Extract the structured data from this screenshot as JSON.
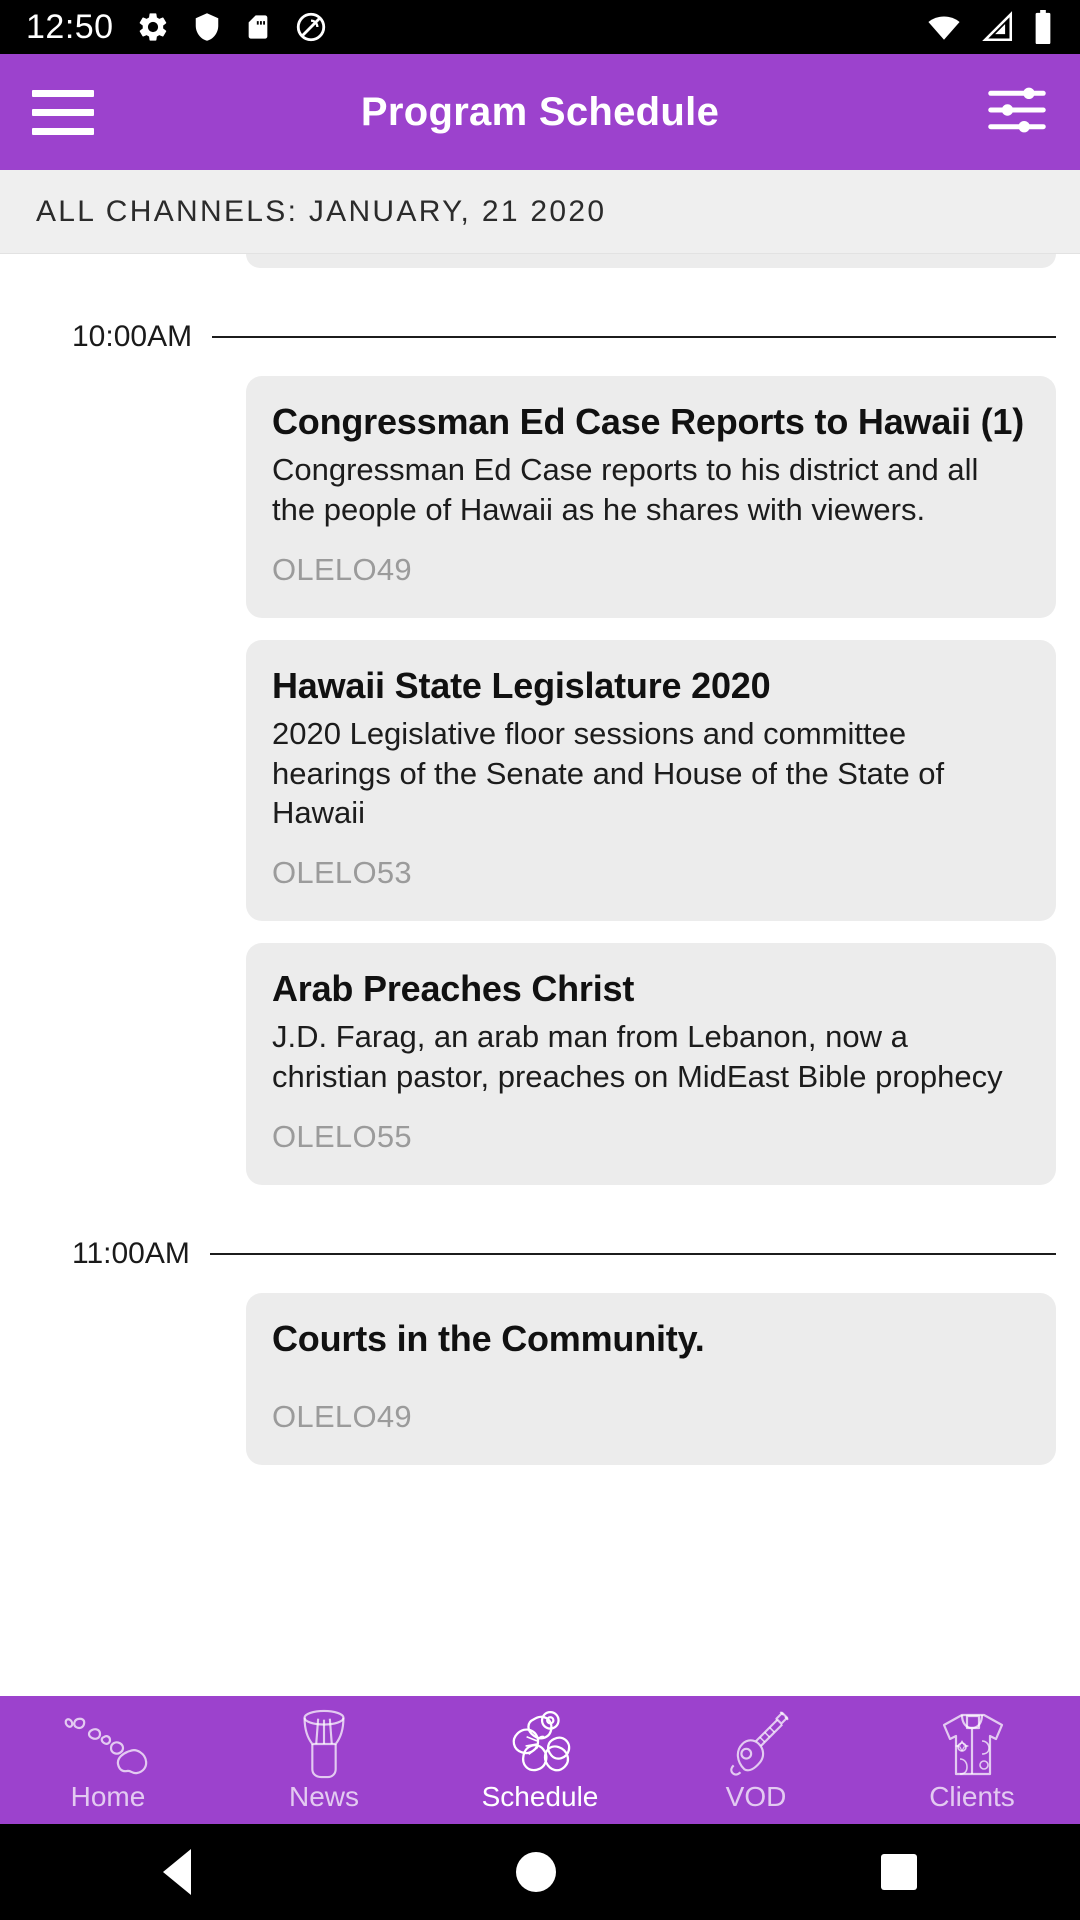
{
  "status_bar": {
    "time": "12:50",
    "left_icons": [
      "gear-icon",
      "shield-icon",
      "sd-card-icon",
      "no-sign-icon"
    ],
    "right_icons": [
      "wifi-icon",
      "cellular-signal-icon",
      "battery-icon"
    ]
  },
  "app_bar": {
    "menu_icon": "hamburger-menu-icon",
    "title": "Program Schedule",
    "filter_icon": "filter-sliders-icon",
    "background_color": "#9c42cd"
  },
  "sub_header": {
    "text": "ALL CHANNELS: JANUARY, 21 2020"
  },
  "schedule": {
    "groups": [
      {
        "time": "10:00AM",
        "programs": [
          {
            "title": "Congressman Ed Case Reports to Hawaii (1)",
            "description": "Congressman Ed Case reports to his district and all the people of Hawaii as he shares with viewers.",
            "channel": "OLELO49"
          },
          {
            "title": "Hawaii State Legislature 2020",
            "description": "2020 Legislative floor sessions and committee hearings of the Senate and House of the State of Hawaii",
            "channel": "OLELO53"
          },
          {
            "title": "Arab Preaches Christ",
            "description": "J.D. Farag, an arab man from Lebanon, now a christian pastor, preaches on MidEast Bible prophecy",
            "channel": "OLELO55"
          }
        ]
      },
      {
        "time": "11:00AM",
        "programs": [
          {
            "title": "Courts in the Community.",
            "description": "",
            "channel": "OLELO49"
          }
        ]
      }
    ]
  },
  "bottom_nav": {
    "items": [
      {
        "label": "Home",
        "icon": "hawaiian-islands-icon",
        "active": false
      },
      {
        "label": "News",
        "icon": "hawaiian-drum-icon",
        "active": false
      },
      {
        "label": "Schedule",
        "icon": "hibiscus-flower-icon",
        "active": true
      },
      {
        "label": "VOD",
        "icon": "ukulele-icon",
        "active": false
      },
      {
        "label": "Clients",
        "icon": "aloha-shirt-icon",
        "active": false
      }
    ]
  },
  "android_nav": {
    "back_label": "back-button",
    "home_label": "home-button",
    "recents_label": "recents-button"
  }
}
